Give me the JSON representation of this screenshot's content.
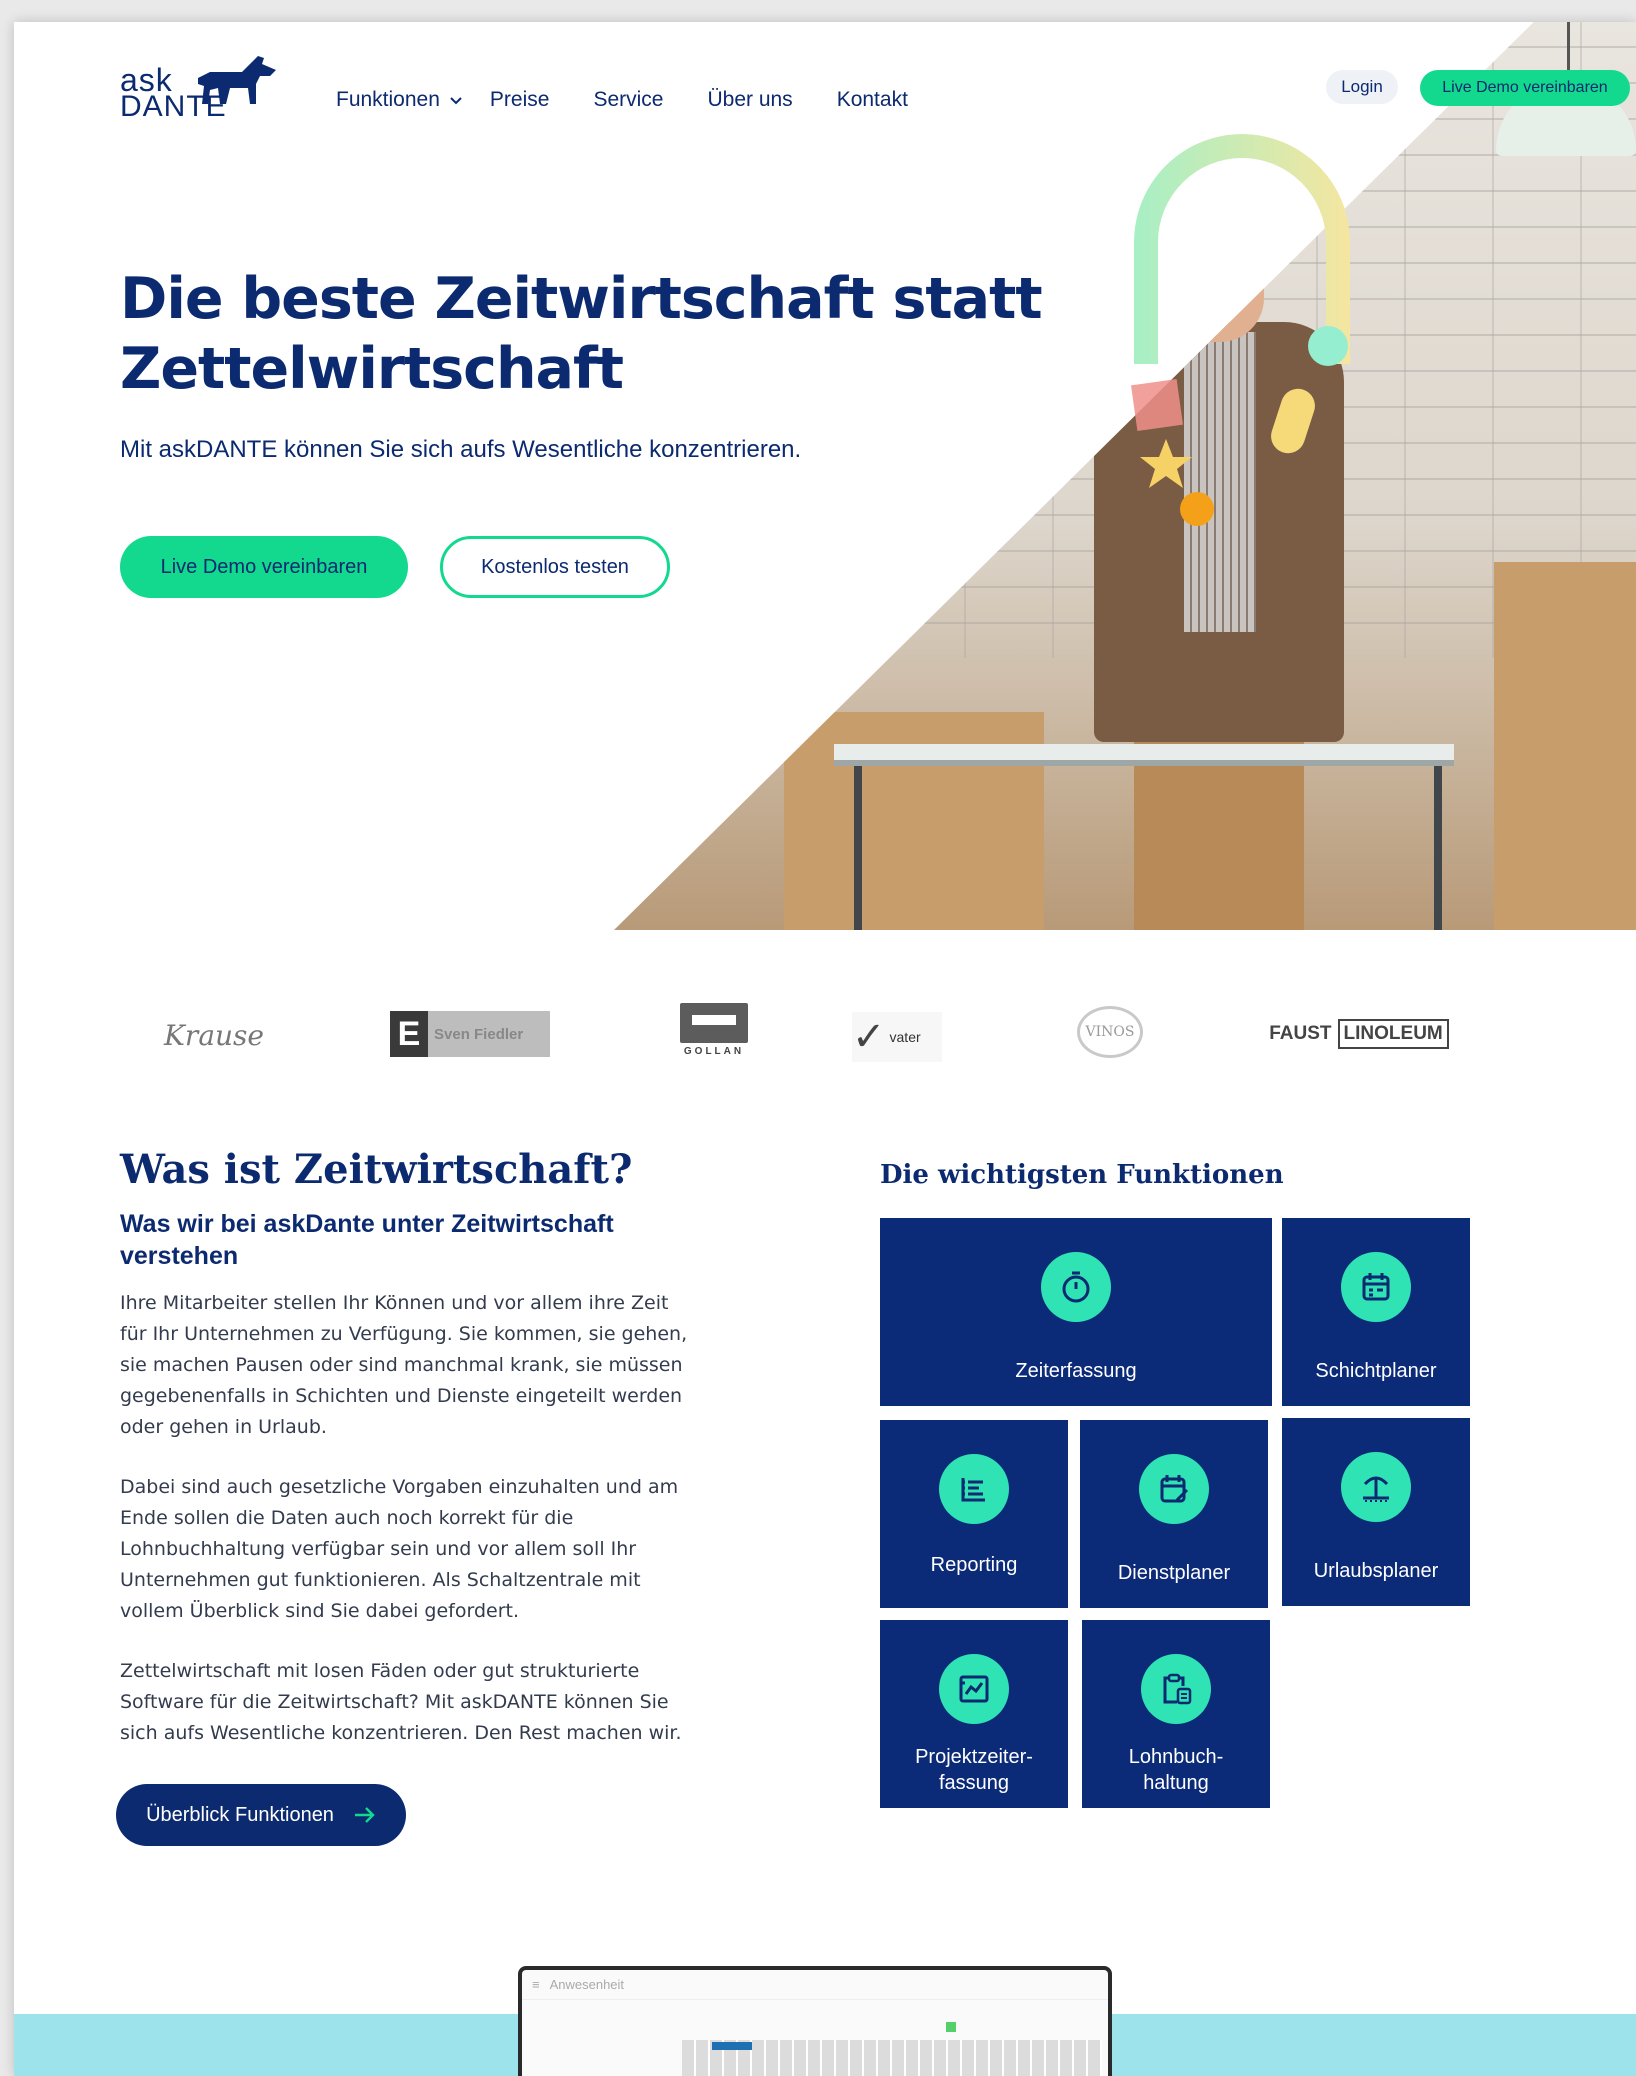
{
  "header": {
    "logo_ask": "ask",
    "logo_dante": "DANTE",
    "nav": [
      {
        "label": "Funktionen",
        "has_dropdown": true
      },
      {
        "label": "Preise"
      },
      {
        "label": "Service"
      },
      {
        "label": "Über uns"
      },
      {
        "label": "Kontakt"
      }
    ],
    "login_label": "Login",
    "demo_label": "Live Demo vereinbaren"
  },
  "hero": {
    "title": "Die beste Zeitwirtschaft statt Zettelwirtschaft",
    "subtitle": "Mit askDANTE können Sie sich aufs Wesentliche konzentrieren.",
    "primary_cta": "Live Demo vereinbaren",
    "secondary_cta": "Kostenlos testen"
  },
  "client_logos": {
    "krause": "Krause",
    "edeka_letter": "E",
    "edeka_text": "Sven Fiedler",
    "gollan": "GOLLAN",
    "vater": "vater",
    "vinos": "VINOS",
    "faust_a": "FAUST",
    "faust_b": "LINOLEUM"
  },
  "about": {
    "title": "Was ist Zeitwirtschaft?",
    "subtitle": "Was wir bei askDante unter Zeitwirtschaft verstehen",
    "p1": "Ihre Mitarbeiter stellen Ihr Können und vor allem ihre Zeit für Ihr Unternehmen zu Verfügung. Sie kommen, sie gehen, sie machen Pausen oder sind manchmal krank, sie müssen gegebenenfalls in Schichten und Dienste eingeteilt werden oder gehen in Urlaub.",
    "p2": "Dabei sind auch gesetzliche Vorgaben einzuhalten und am Ende sollen die Daten auch noch korrekt für die Lohnbuchhaltung verfügbar sein und vor allem soll Ihr Unternehmen gut funktionieren. Als Schaltzentrale mit vollem Überblick sind Sie dabei gefordert.",
    "p3": "Zettelwirtschaft mit losen Fäden oder gut strukturierte Software für die Zeitwirtschaft? Mit askDANTE können Sie sich aufs Wesentliche konzentrieren. Den Rest machen wir.",
    "cta": "Überblick Funktionen"
  },
  "features": {
    "title": "Die wichtigsten Funktionen",
    "items": [
      {
        "label": "Zeiterfassung",
        "icon": "stopwatch-icon"
      },
      {
        "label": "Schichtplaner",
        "icon": "calendar-grid-icon"
      },
      {
        "label": "Reporting",
        "icon": "list-report-icon"
      },
      {
        "label": "Dienstplaner",
        "icon": "calendar-edit-icon"
      },
      {
        "label": "Urlaubsplaner",
        "icon": "palm-tree-icon"
      },
      {
        "label": "Projektzeiter-\nfassung",
        "icon": "chart-board-icon"
      },
      {
        "label": "Lohnbuch-\nhaltung",
        "icon": "clipboard-calculator-icon"
      }
    ]
  },
  "preview": {
    "app_title": "Anwesenheit"
  },
  "colors": {
    "brand_navy": "#0b2a6f",
    "brand_green": "#13d98e",
    "tile_blue": "#0b2a78",
    "icon_mint": "#2fe3b4",
    "band_teal": "#9de3eb"
  }
}
